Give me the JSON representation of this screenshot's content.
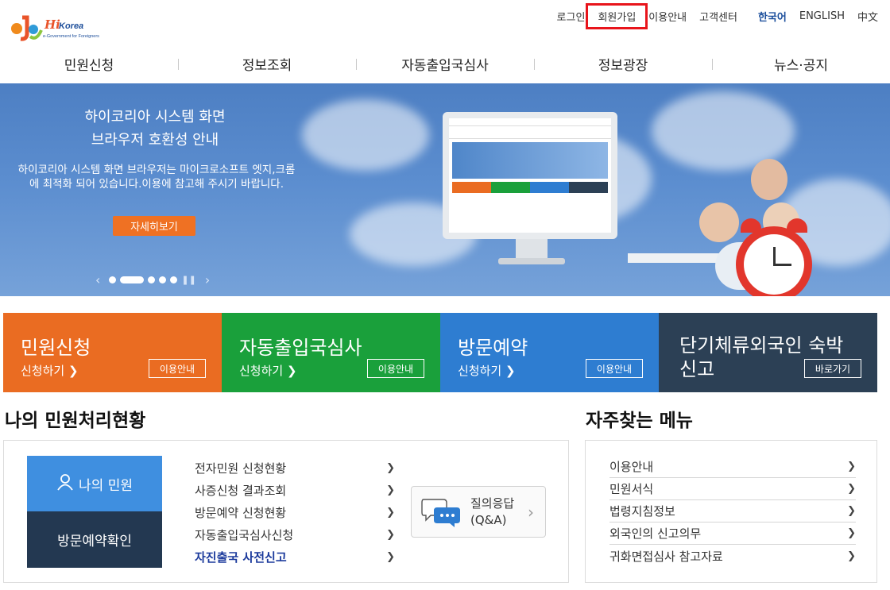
{
  "header": {
    "logo_text": "Hi Korea",
    "logo_sub": "e-Government for Foreigners",
    "util_links": [
      "로그인",
      "회원가입",
      "이용안내",
      "고객센터"
    ],
    "languages": [
      "한국어",
      "ENGLISH",
      "中文"
    ]
  },
  "nav": [
    "민원신청",
    "정보조회",
    "자동출입국심사",
    "정보광장",
    "뉴스·공지"
  ],
  "hero": {
    "title_line1": "하이코리아 시스템 화면",
    "title_line2": "브라우저 호환성 안내",
    "description": "하이코리아 시스템 화면 브라우저는 마이크로소프트 엣지,크롬에 최적화 되어 있습니다.이용에 참고해 주시기 바랍니다.",
    "button": "자세히보기"
  },
  "tiles": [
    {
      "title": "민원신청",
      "apply": "신청하기",
      "button": "이용안내",
      "color": "#ea6c22"
    },
    {
      "title": "자동출입국심사",
      "apply": "신청하기",
      "button": "이용안내",
      "color": "#1aa03b"
    },
    {
      "title": "방문예약",
      "apply": "신청하기",
      "button": "이용안내",
      "color": "#2e7dd1"
    },
    {
      "title": "단기체류외국인 숙박신고",
      "title_line1": "단기체류외국인 숙박",
      "title_line2": "신고",
      "button": "바로가기",
      "color": "#2c4055"
    }
  ],
  "status": {
    "heading": "나의 민원처리현황",
    "my_button": "나의 민원",
    "visit_button": "방문예약확인",
    "links": [
      "전자민원 신청현황",
      "사증신청 결과조회",
      "방문예약 신청현황",
      "자동출입국심사신청",
      "자진출국 사전신고"
    ],
    "qna_line1": "질의응답",
    "qna_line2": "(Q&A)"
  },
  "frequent": {
    "heading": "자주찾는 메뉴",
    "items": [
      "이용안내",
      "민원서식",
      "법령지침정보",
      "외국인의 신고의무",
      "귀화면접심사 참고자료"
    ]
  }
}
